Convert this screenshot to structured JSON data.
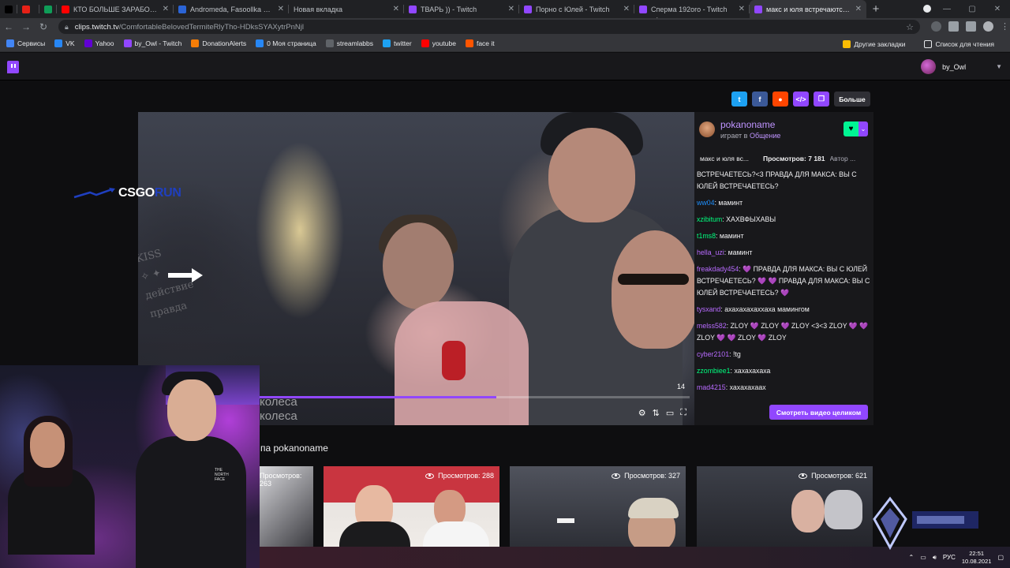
{
  "browser": {
    "tabs": [
      {
        "label": "",
        "icon": "tiktok-icon",
        "color": "#000000"
      },
      {
        "label": "",
        "icon": "youtube-studio-icon",
        "color": "#e62117"
      },
      {
        "label": "",
        "icon": "sheets-icon",
        "color": "#0f9d58"
      },
      {
        "label": "КТО БОЛЬШЕ ЗАРАБОТАЕТ ...",
        "icon": "youtube-icon",
        "color": "#ff0000"
      },
      {
        "label": "Andromeda, Fasoollka — Pla...",
        "icon": "app-icon",
        "color": "#2b64d6"
      },
      {
        "label": "Новая вкладка",
        "icon": "",
        "color": ""
      },
      {
        "label": "ТВАРЬ )) - Twitch",
        "icon": "twitch-icon",
        "color": "#9147ff"
      },
      {
        "label": "Порно с Юлей - Twitch",
        "icon": "twitch-icon",
        "color": "#9147ff"
      },
      {
        "label": "Сперма 192oro - Twitch",
        "icon": "twitch-icon",
        "color": "#9147ff"
      },
      {
        "label": "макс и юля встречаются (М...",
        "icon": "twitch-icon",
        "color": "#9147ff",
        "active": true
      }
    ],
    "url_domain": "clips.twitch.tv",
    "url_path": "/ComfortableBelovedTermiteRlyTho-HDksSYAXytrPnNjl",
    "bookmarks": [
      "Сервисы",
      "VK",
      "Yahoo",
      "by_Owl - Twitch",
      "DonationAlerts",
      "0 Моя страница",
      "streamlabbs",
      "twitter",
      "youtube",
      "face it"
    ],
    "bookmarks_right": [
      "Другие закладки",
      "Список для чтения"
    ]
  },
  "twitch": {
    "username": "by_Owl",
    "share_more": "Больше",
    "streamer": "pokanoname",
    "plays_prefix": "играет в",
    "category": "Общение",
    "clip_title": "макс и юля вс...",
    "views_label": "Просмотров: 7 181",
    "author": "Автор ...",
    "watch_full": "Смотреть видео целиком",
    "clips_heading": "па pokanoname",
    "player": {
      "progress": 0.55,
      "time": "14",
      "caption_line1": "колеса",
      "caption_line2": "колеса",
      "overlay_brand_1": "CSGO",
      "overlay_brand_2": "RUN"
    },
    "chat": [
      {
        "user": "",
        "color": "#efeff1",
        "text": "ВСТРЕЧАЕТЕСЬ?<3 ПРАВДА ДЛЯ МАКСА: ВЫ С ЮЛЕЙ ВСТРЕЧАЕТЕСЬ?"
      },
      {
        "user": "ww04",
        "color": "#1e90ff",
        "text": "маминт"
      },
      {
        "user": "xzibitum",
        "color": "#00ff7f",
        "text": "ХАХВФЫХАВЫ"
      },
      {
        "user": "t1ms8",
        "color": "#00ff7f",
        "text": "маминт"
      },
      {
        "user": "hella_uzi",
        "color": "#b86bff",
        "text": "маминт"
      },
      {
        "user": "freakdady454",
        "color": "#b86bff",
        "text": "💜 ПРАВДА ДЛЯ МАКСА: ВЫ С ЮЛЕЙ ВСТРЕЧАЕТЕСЬ? 💜 💜 ПРАВДА ДЛЯ МАКСА: ВЫ С ЮЛЕЙ ВСТРЕЧАЕТЕСЬ? 💜"
      },
      {
        "user": "tysxand",
        "color": "#b86bff",
        "text": "ахахахахаххаха мамингом"
      },
      {
        "user": "melss582",
        "color": "#b86bff",
        "text": "ZLOY 💜 ZLOY 💜 ZLOY <3<3 ZLOY 💜 💜 ZLOY 💜 💜 ZLOY 💜 ZLOY"
      },
      {
        "user": "cyber2101",
        "color": "#b86bff",
        "text": "!tg"
      },
      {
        "user": "zzombiee1",
        "color": "#00ff7f",
        "text": "хахахахаха"
      },
      {
        "user": "mad4215",
        "color": "#b86bff",
        "text": "хахахахаах"
      }
    ],
    "clips": [
      {
        "views": "Просмотров: 263"
      },
      {
        "views": "Просмотров: 288"
      },
      {
        "views": "Просмотров: 327"
      },
      {
        "views": "Просмотров: 621"
      }
    ]
  },
  "taskbar": {
    "lang": "РУС",
    "time": "22:51",
    "date": "10.08.2021"
  },
  "colors": {
    "twitch_purple": "#9147ff",
    "follow_green": "#00f593"
  }
}
